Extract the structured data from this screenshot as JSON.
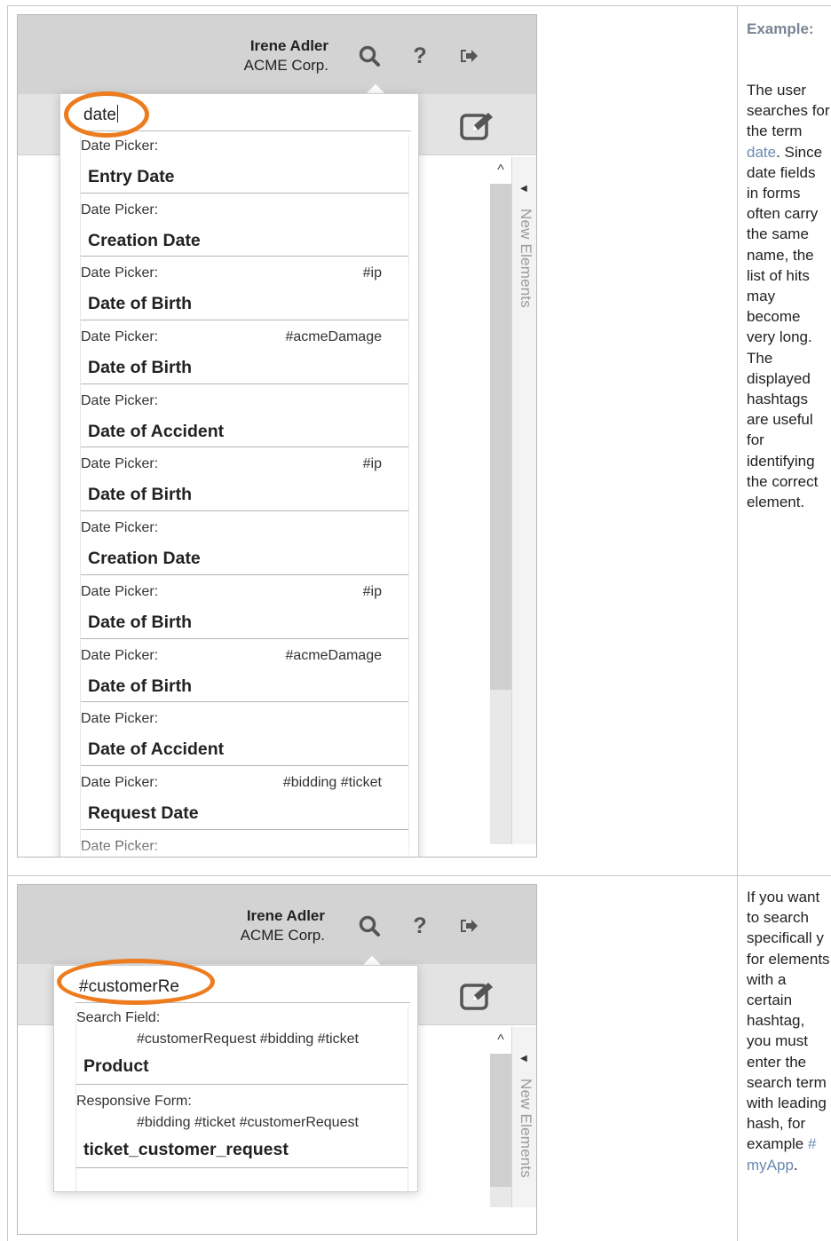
{
  "example1": {
    "heading": "Example:",
    "note_before": "The user searches for the term ",
    "note_link": "date",
    "note_after": ". Since date fields in forms often carry the same name, the list of hits may become very long. The displayed hashtags are useful for identifying the correct element.",
    "app": {
      "user_name": "Irene Adler",
      "user_org": "ACME Corp.",
      "search_value": "date",
      "side_tab_label": "New Elements",
      "results": [
        {
          "type": "Date Picker:",
          "tags": "",
          "name": "Entry Date"
        },
        {
          "type": "Date Picker:",
          "tags": "",
          "name": "Creation Date"
        },
        {
          "type": "Date Picker:",
          "tags": "#ip",
          "name": "Date of Birth"
        },
        {
          "type": "Date Picker:",
          "tags": "#acmeDamage",
          "name": "Date of Birth"
        },
        {
          "type": "Date Picker:",
          "tags": "",
          "name": "Date of Accident"
        },
        {
          "type": "Date Picker:",
          "tags": "#ip",
          "name": "Date of Birth"
        },
        {
          "type": "Date Picker:",
          "tags": "",
          "name": "Creation Date"
        },
        {
          "type": "Date Picker:",
          "tags": "#ip",
          "name": "Date of Birth"
        },
        {
          "type": "Date Picker:",
          "tags": "#acmeDamage",
          "name": "Date of Birth"
        },
        {
          "type": "Date Picker:",
          "tags": "",
          "name": "Date of Accident"
        },
        {
          "type": "Date Picker:",
          "tags": "#bidding #ticket",
          "name": "Request Date"
        },
        {
          "type": "Date Picker:",
          "tags": "",
          "name": ""
        }
      ]
    }
  },
  "example2": {
    "note_before": "If you want to search specificall y for elements with a certain hashtag, you must enter the search term with leading hash, for example ",
    "note_link": "# myApp",
    "note_after": ".",
    "app": {
      "user_name": "Irene Adler",
      "user_org": "ACME Corp.",
      "search_value": "#customerRe",
      "side_tab_label": "New Elements",
      "results": [
        {
          "type": "Search Field:",
          "tags": "#customerRequest #bidding #ticket",
          "name": "Product"
        },
        {
          "type": "Responsive Form:",
          "tags": "#bidding #ticket #customerRequest",
          "name": "ticket_customer_request"
        }
      ]
    }
  },
  "colors": {
    "highlight": "#ec7c1e",
    "link": "#6a8ab5",
    "topbar": "#d3d3d3"
  },
  "icons": [
    "search-icon",
    "help-icon",
    "logout-icon",
    "edit-icon",
    "chevron-up-icon",
    "chevron-left-icon"
  ]
}
